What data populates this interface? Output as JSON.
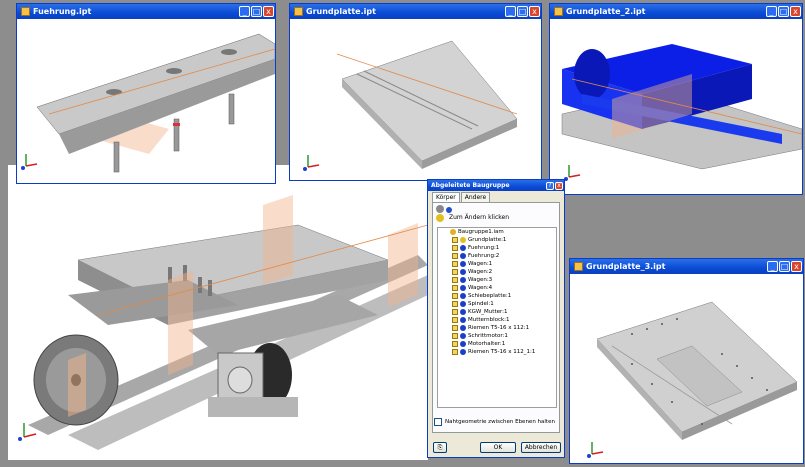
{
  "windows": {
    "w1": {
      "title": "Fuehrung.ipt"
    },
    "w2": {
      "title": "Grundplatte.ipt"
    },
    "w3": {
      "title": "Grundplatte_2.ipt"
    },
    "w4": {
      "title": "Grundplatte_3.ipt"
    }
  },
  "titlebar_buttons": {
    "minimize": "_",
    "maximize": "□",
    "close": "x"
  },
  "dialog": {
    "title": "Abgeleitete Baugruppe",
    "tabs": [
      "Körper",
      "Andere"
    ],
    "hint": "Zum Ändern klicken",
    "tree_root": "Baugruppe1.iam",
    "tree_items": [
      "Grundplatte:1",
      "Fuehrung:1",
      "Fuehrung:2",
      "Wagen:1",
      "Wagen:2",
      "Wagen:3",
      "Wagen:4",
      "Schiebeplatte:1",
      "Spindel:1",
      "KGW_Mutter:1",
      "Mutternblock:1",
      "Riemen T5-16 x 112:1",
      "Schrittmotor:1",
      "Motorhalter:1",
      "Riemen T5-16 x 112_1:1"
    ],
    "checkbox_label": "Nahtgeometrie zwischen Ebenen halten",
    "ok_label": "OK",
    "cancel_label": "Abbrechen"
  },
  "colors": {
    "titlebar": "#0a4bd6",
    "body_blue": "#0b1fe6",
    "accent_orange": "#e08a4a"
  }
}
